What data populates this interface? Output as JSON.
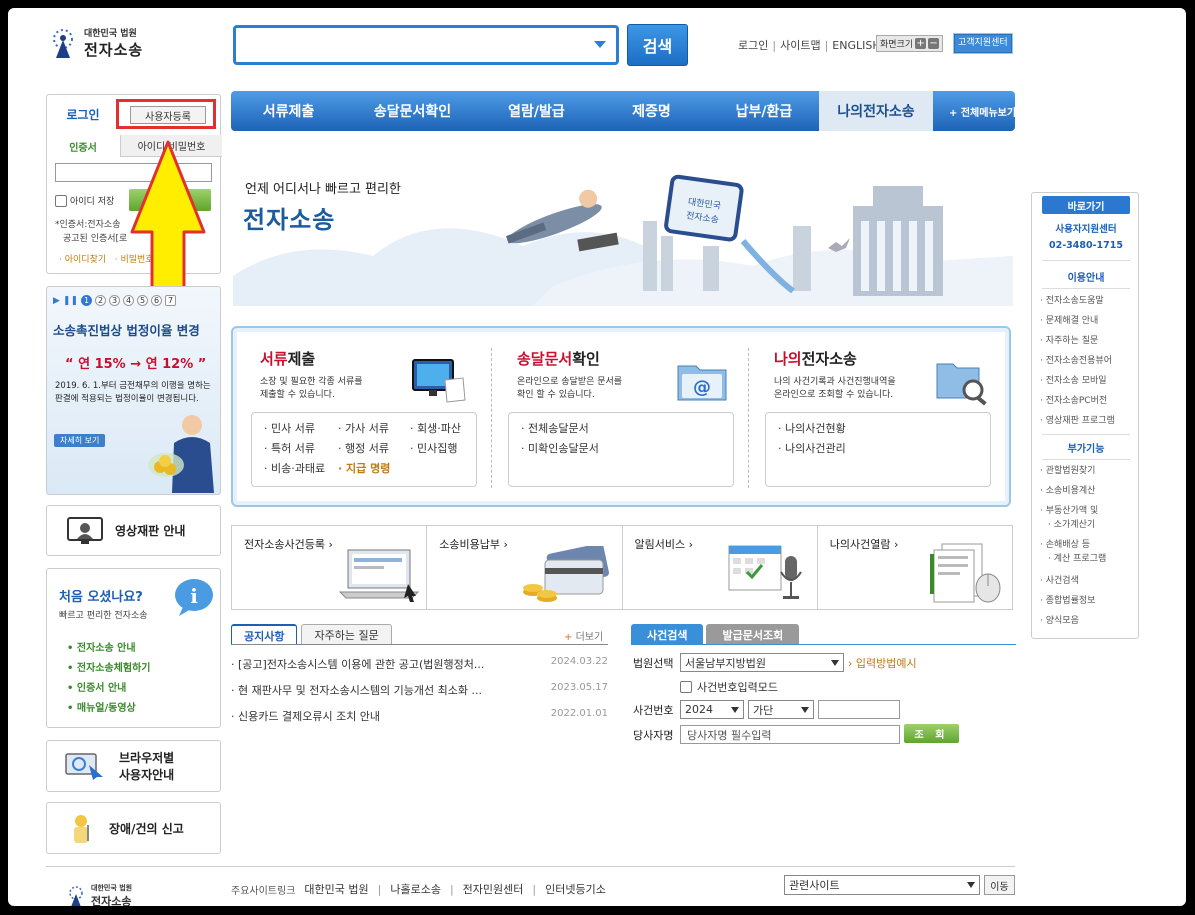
{
  "header": {
    "logo_small": "대한민국 법원",
    "logo_main": "전자소송",
    "search_button": "검색",
    "top_links": [
      "로그인",
      "사이트맵",
      "ENGLISH"
    ],
    "font_size_label": "화면크기",
    "font_plus": "+",
    "font_minus": "−",
    "support_center": "고객지원센터"
  },
  "nav": {
    "items": [
      "서류제출",
      "송달문서확인",
      "열람/발급",
      "제증명",
      "납부/환급",
      "나의전자소송"
    ],
    "active": "나의전자소송",
    "all_menu": "+ 전체메뉴보기"
  },
  "login": {
    "tab": "로그인",
    "register_button": "사용자등록",
    "sub_tab_cert": "인증서",
    "sub_tab_id": "아이디/비밀번호",
    "id_save": "아이디 저장",
    "note_line1": "*인증서:전자소송",
    "note_line2": "공고된 인증서[로",
    "find_id": "아이디찾기",
    "find_pw": "비밀번호찾기"
  },
  "promo": {
    "pages": [
      "1",
      "2",
      "3",
      "4",
      "5",
      "6",
      "7"
    ],
    "active_page": "1",
    "title": "소송촉진법상 법정이율 변경",
    "rate_from": "연 15%",
    "rate_to": "연 12%",
    "desc": "2019. 6. 1.부터 금전채무의 이행을 명하는 판결에 적용되는 법정이율이 변경됩니다.",
    "button": "자세히 보기"
  },
  "side": {
    "video_trial": "영상재판 안내",
    "browser_guide_1": "브라우저별",
    "browser_guide_2": "사용자안내",
    "report": "장애/건의 신고"
  },
  "welcome": {
    "title": "처음 오셨나요?",
    "subtitle": "빠르고 편리한 전자소송",
    "items": [
      "전자소송 안내",
      "전자소송체험하기",
      "인증서 안내",
      "매뉴얼/동영상"
    ]
  },
  "banner": {
    "line1": "언제 어디서나 빠르고 편리한",
    "line2": "전자소송"
  },
  "services": [
    {
      "title_hl": "서류",
      "title_rest": "제출",
      "desc1": "소장 및 필요한 각종 서류를",
      "desc2": "제출할 수 있습니다.",
      "links": [
        "민사 서류",
        "가사 서류",
        "회생·파산",
        "특허 서류",
        "행정 서류",
        "민사집행",
        "비송·과태료",
        "지급 명령"
      ]
    },
    {
      "title_hl": "송달문서",
      "title_rest": "확인",
      "desc1": "온라인으로 송달받은 문서를",
      "desc2": "확인 할 수 있습니다.",
      "links": [
        "전체송달문서",
        "미확인송달문서"
      ]
    },
    {
      "title_hl": "나의",
      "title_rest": "전자소송",
      "desc1": "나의 사건기록과 사건진행내역을",
      "desc2": "온라인으로 조회할 수 있습니다.",
      "links": [
        "나의사건현황",
        "나의사건관리"
      ]
    }
  ],
  "quick": [
    "전자소송사건등록 ›",
    "소송비용납부 ›",
    "알림서비스 ›",
    "나의사건열람 ›"
  ],
  "notices": {
    "tabs": [
      "공지사항",
      "자주하는 질문"
    ],
    "more": "더보기",
    "items": [
      {
        "title": "[공고]전자소송시스템 이용에 관한 공고(법원행정처...",
        "date": "2024.03.22"
      },
      {
        "title": "현 재판사무 및 전자소송시스템의 기능개선 최소화 ...",
        "date": "2023.05.17"
      },
      {
        "title": "신용카드 결제오류시 조치 안내",
        "date": "2022.01.01"
      }
    ]
  },
  "case_search": {
    "tabs": [
      "사건검색",
      "발급문서조회"
    ],
    "court_label": "법원선택",
    "court_value": "서울남부지방법원",
    "input_guide": "입력방법예시",
    "direct_input": "사건번호입력모드",
    "case_no_label": "사건번호",
    "year": "2024",
    "type": "가단",
    "party_label": "당사자명",
    "party_placeholder": "당사자명 필수입력",
    "search_btn": "조 회"
  },
  "right_quick": {
    "head": "바로가기",
    "center_name": "사용자지원센터",
    "center_phone": "02-3480-1715",
    "sec1": "이용안내",
    "sec1_items": [
      "전자소송도움말",
      "문제해결 안내",
      "자주하는 질문",
      "전자소송전용뷰어",
      "전자소송 모바일",
      "전자소송PC버전",
      "영상재판 프로그램"
    ],
    "sec2": "부가기능",
    "sec2_items": [
      "관할법원찾기",
      "소송비용계산",
      "부동산가액 및",
      "소가계산기",
      "손해배상 등",
      "계산 프로그램",
      "사건검색",
      "종합법률정보",
      "양식모음"
    ]
  },
  "footer": {
    "logo_small": "대한민국 법원",
    "logo_main": "전자소송",
    "links": [
      "주요사이트링크",
      "대한민국 법원",
      "나홀로소송",
      "전자민원센터",
      "인터넷등기소"
    ],
    "related": "관련사이트",
    "go": "이동"
  },
  "colors": {
    "brand_blue": "#1d63b8",
    "accent_red": "#c8102e",
    "green": "#3a8a2a"
  }
}
